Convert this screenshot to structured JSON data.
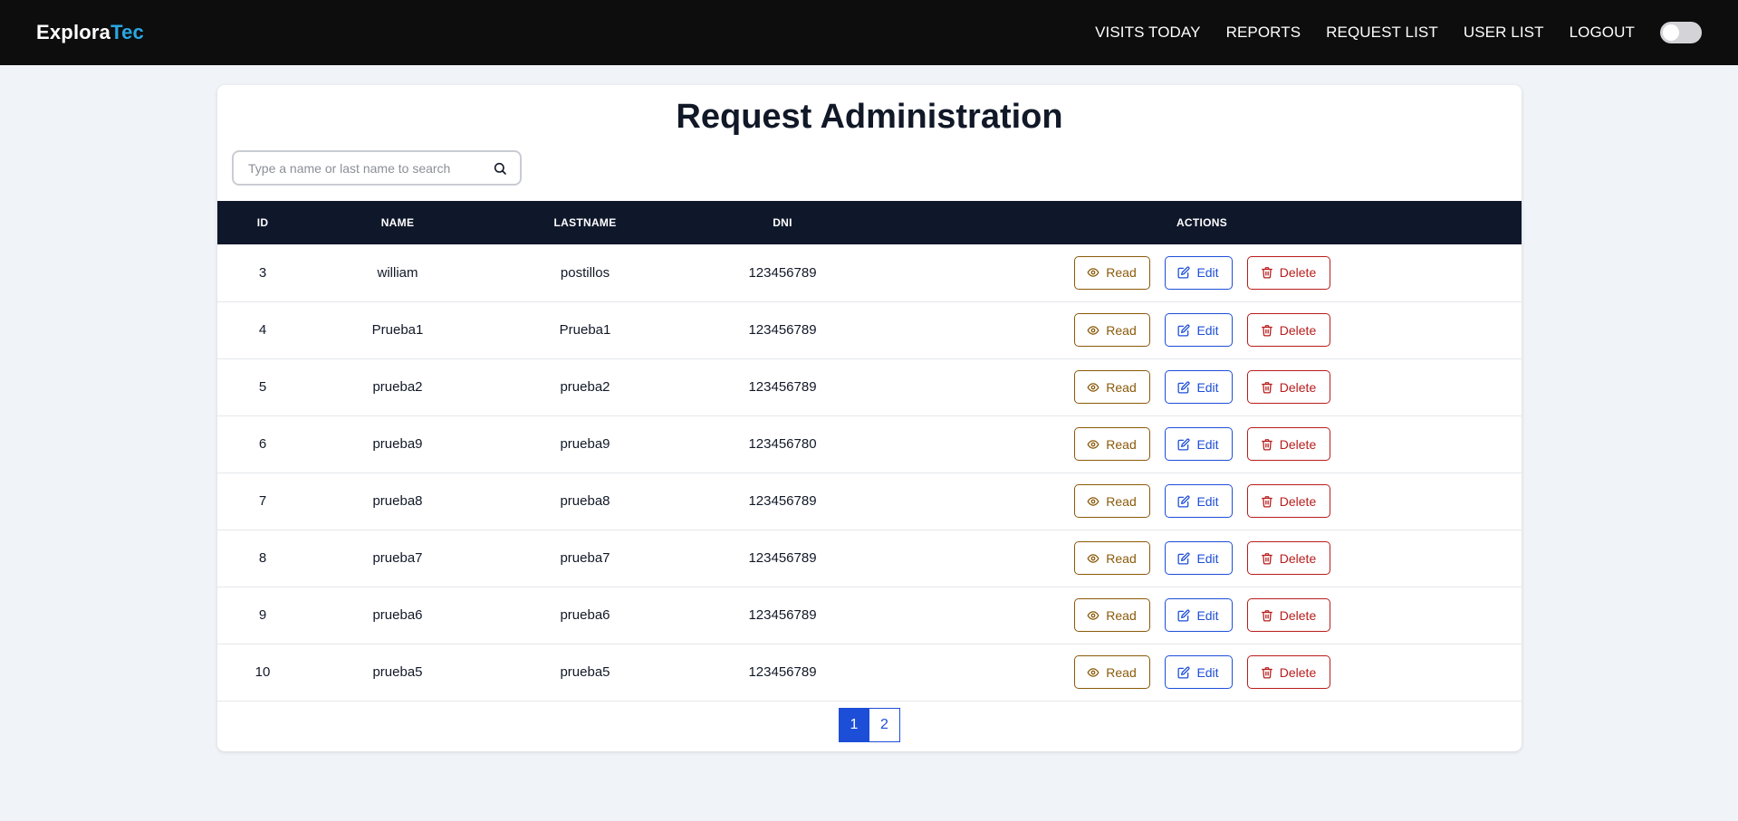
{
  "navbar": {
    "brand_part1": "Explora",
    "brand_part2": "Tec",
    "links": [
      "VISITS TODAY",
      "REPORTS",
      "REQUEST LIST",
      "USER LIST",
      "LOGOUT"
    ],
    "theme_toggle_on": false
  },
  "page": {
    "title": "Request Administration"
  },
  "search": {
    "placeholder": "Type a name or last name to search",
    "value": ""
  },
  "table": {
    "headers": [
      "ID",
      "NAME",
      "LASTNAME",
      "DNI",
      "ACTIONS"
    ],
    "rows": [
      {
        "id": "3",
        "name": "william",
        "lastname": "postillos",
        "dni": "123456789"
      },
      {
        "id": "4",
        "name": "Prueba1",
        "lastname": "Prueba1",
        "dni": "123456789"
      },
      {
        "id": "5",
        "name": "prueba2",
        "lastname": "prueba2",
        "dni": "123456789"
      },
      {
        "id": "6",
        "name": "prueba9",
        "lastname": "prueba9",
        "dni": "123456780"
      },
      {
        "id": "7",
        "name": "prueba8",
        "lastname": "prueba8",
        "dni": "123456789"
      },
      {
        "id": "8",
        "name": "prueba7",
        "lastname": "prueba7",
        "dni": "123456789"
      },
      {
        "id": "9",
        "name": "prueba6",
        "lastname": "prueba6",
        "dni": "123456789"
      },
      {
        "id": "10",
        "name": "prueba5",
        "lastname": "prueba5",
        "dni": "123456789"
      }
    ],
    "actions": {
      "read": "Read",
      "edit": "Edit",
      "delete": "Delete"
    }
  },
  "pagination": {
    "pages": [
      "1",
      "2"
    ],
    "current": "1"
  },
  "colors": {
    "navbar_bg": "#0d0d0d",
    "brand_accent": "#2aa7e4",
    "table_header_bg": "#0f172a",
    "read": "#8a5a0a",
    "edit": "#1d4ed8",
    "delete": "#b91c1c",
    "page_bg": "#f0f3f8"
  }
}
